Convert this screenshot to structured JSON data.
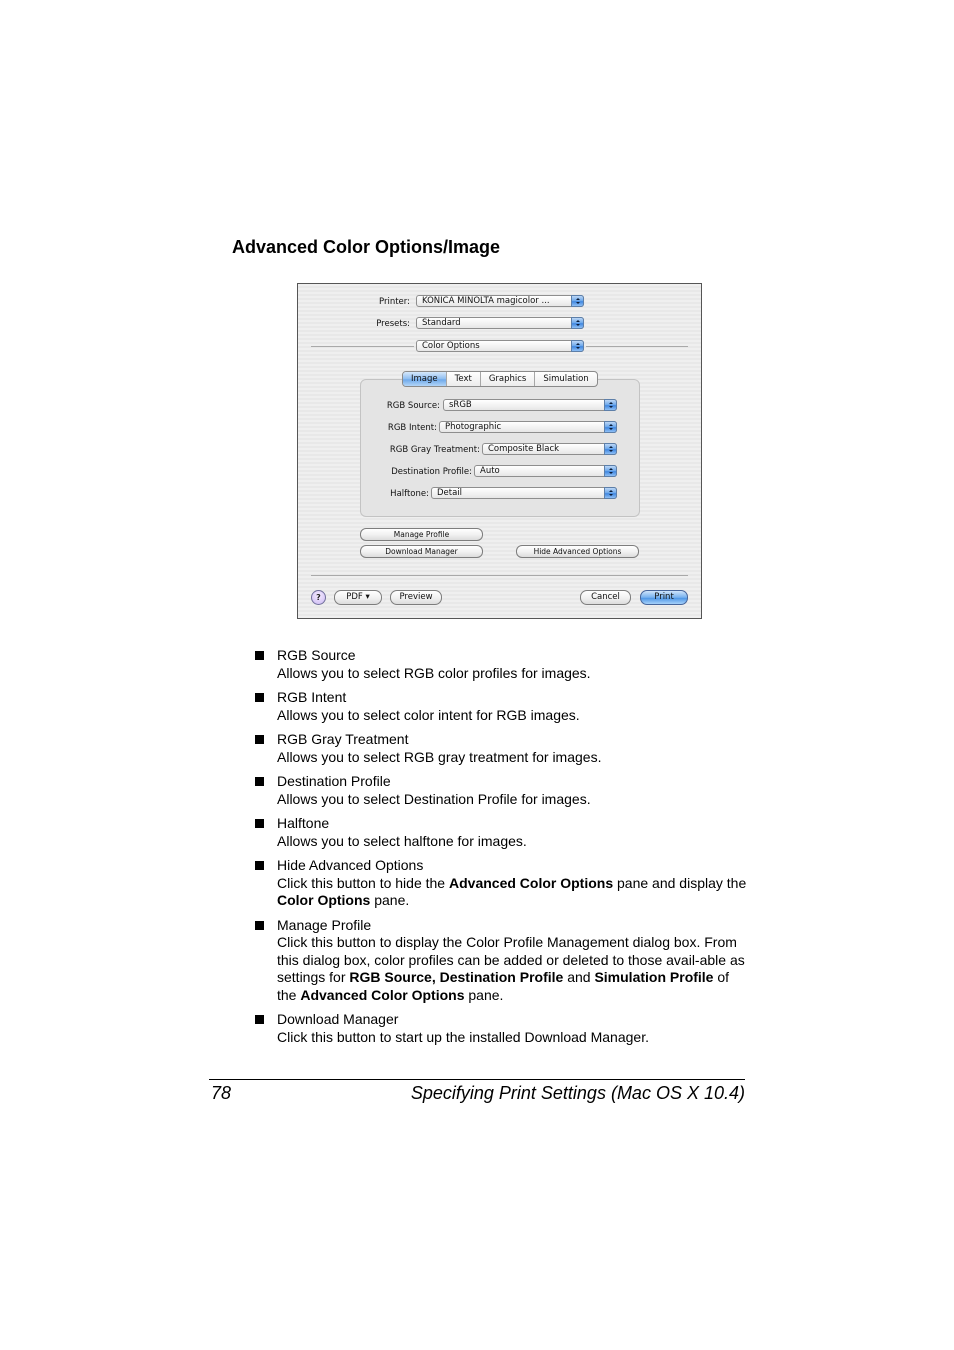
{
  "section_title": "Advanced Color Options/Image",
  "dialog": {
    "printer": {
      "label": "Printer:",
      "value": "KONICA MINOLTA magicolor ..."
    },
    "presets": {
      "label": "Presets:",
      "value": "Standard"
    },
    "pane_select": {
      "value": "Color Options"
    },
    "tabs": [
      {
        "label": "Image",
        "active": true
      },
      {
        "label": "Text",
        "active": false
      },
      {
        "label": "Graphics",
        "active": false
      },
      {
        "label": "Simulation",
        "active": false
      }
    ],
    "fields": {
      "rgb_source": {
        "label": "RGB Source:",
        "value": "sRGB"
      },
      "rgb_intent": {
        "label": "RGB Intent:",
        "value": "Photographic"
      },
      "rgb_gray_treatment": {
        "label": "RGB Gray Treatment:",
        "value": "Composite Black"
      },
      "destination_profile": {
        "label": "Destination Profile:",
        "value": "Auto"
      },
      "halftone": {
        "label": "Halftone:",
        "value": "Detail"
      }
    },
    "buttons": {
      "manage_profile": "Manage Profile",
      "download_manager": "Download Manager",
      "hide_advanced": "Hide Advanced Options",
      "help": "?",
      "pdf": "PDF ▾",
      "preview": "Preview",
      "cancel": "Cancel",
      "print": "Print"
    }
  },
  "items": [
    {
      "title": "RGB Source",
      "text": "Allows you to select RGB color profiles for images."
    },
    {
      "title": "RGB Intent",
      "text": "Allows you to select color intent for RGB images."
    },
    {
      "title": "RGB Gray Treatment",
      "text": "Allows you to select RGB gray treatment for images."
    },
    {
      "title": "Destination Profile",
      "text": "Allows you to select Destination Profile for images."
    },
    {
      "title": "Halftone",
      "text": "Allows you to select halftone for images."
    },
    {
      "title": "Hide Advanced Options",
      "text_parts": [
        "Click this button to hide the ",
        "Advanced Color Options",
        " pane and display the ",
        "Color Options",
        " pane."
      ]
    },
    {
      "title": "Manage Profile",
      "text_parts": [
        "Click this button to display the Color Profile Management dialog box. From this dialog box, color profiles can be added or deleted to those avail-able as settings for ",
        "RGB Source, Destination Profile",
        " and ",
        "Simulation Profile",
        " of the ",
        "Advanced Color Options",
        " pane."
      ]
    },
    {
      "title": "Download Manager",
      "text": "Click this button to start up the installed Download Manager."
    }
  ],
  "footer": {
    "page_number": "78",
    "title": "Specifying Print Settings (Mac OS X 10.4)"
  }
}
